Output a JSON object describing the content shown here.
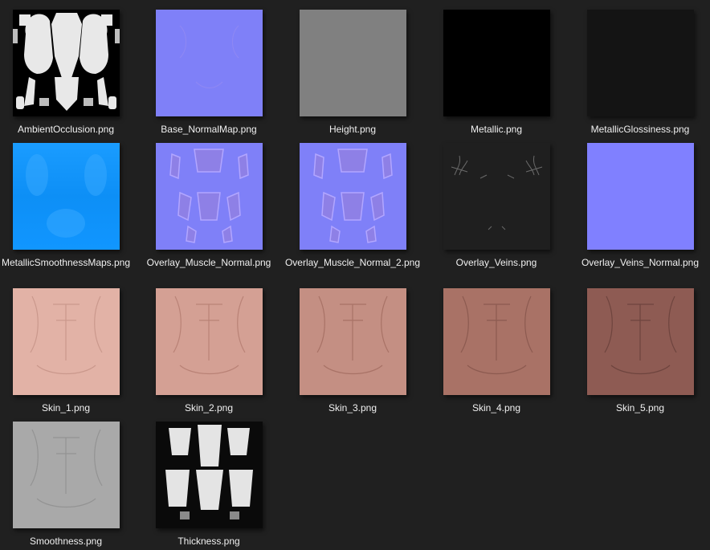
{
  "files": [
    {
      "name": "AmbientOcclusion.png",
      "kind": "ao"
    },
    {
      "name": "Base_NormalMap.png",
      "kind": "normal"
    },
    {
      "name": "Height.png",
      "kind": "height"
    },
    {
      "name": "Metallic.png",
      "kind": "metal"
    },
    {
      "name": "MetallicGlossiness.png",
      "kind": "metalgloss"
    },
    {
      "name": "MetallicSmoothnessMaps.png",
      "kind": "msm"
    },
    {
      "name": "Overlay_Muscle_Normal.png",
      "kind": "muscle"
    },
    {
      "name": "Overlay_Muscle_Normal_2.png",
      "kind": "muscle"
    },
    {
      "name": "Overlay_Veins.png",
      "kind": "veins"
    },
    {
      "name": "Overlay_Veins_Normal.png",
      "kind": "veinsn"
    },
    {
      "name": "Skin_1.png",
      "kind": "skin1"
    },
    {
      "name": "Skin_2.png",
      "kind": "skin2"
    },
    {
      "name": "Skin_3.png",
      "kind": "skin3"
    },
    {
      "name": "Skin_4.png",
      "kind": "skin4"
    },
    {
      "name": "Skin_5.png",
      "kind": "skin5"
    },
    {
      "name": "Smoothness.png",
      "kind": "smooth"
    },
    {
      "name": "Thickness.png",
      "kind": "thick"
    }
  ]
}
